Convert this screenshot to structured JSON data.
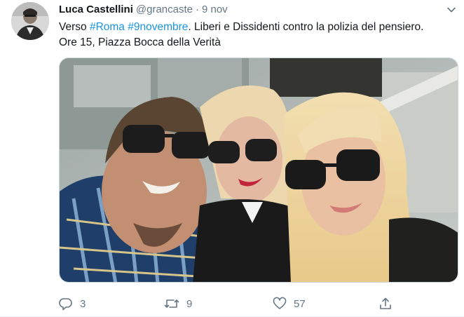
{
  "tweet": {
    "author_name": "Luca Castellini",
    "handle": "@grancaste",
    "separator": "·",
    "time": "9 nov",
    "text_before": "Verso ",
    "hashtag_1": "#Roma",
    "text_between": " ",
    "hashtag_2": "#9novembre",
    "text_after": ". Liberi e Dissidenti contro la polizia del pensiero.",
    "text_line2": "Ore 15, Piazza Bocca della Verità"
  },
  "actions": {
    "reply_count": "3",
    "retweet_count": "9",
    "like_count": "57"
  },
  "icons": {
    "caret": "chevron-down-icon",
    "reply": "reply-icon",
    "retweet": "retweet-icon",
    "like": "heart-icon",
    "share": "share-icon"
  },
  "colors": {
    "text": "#14171a",
    "muted": "#657786",
    "hashtag": "#1b95e0",
    "border": "#e6ecf0"
  }
}
